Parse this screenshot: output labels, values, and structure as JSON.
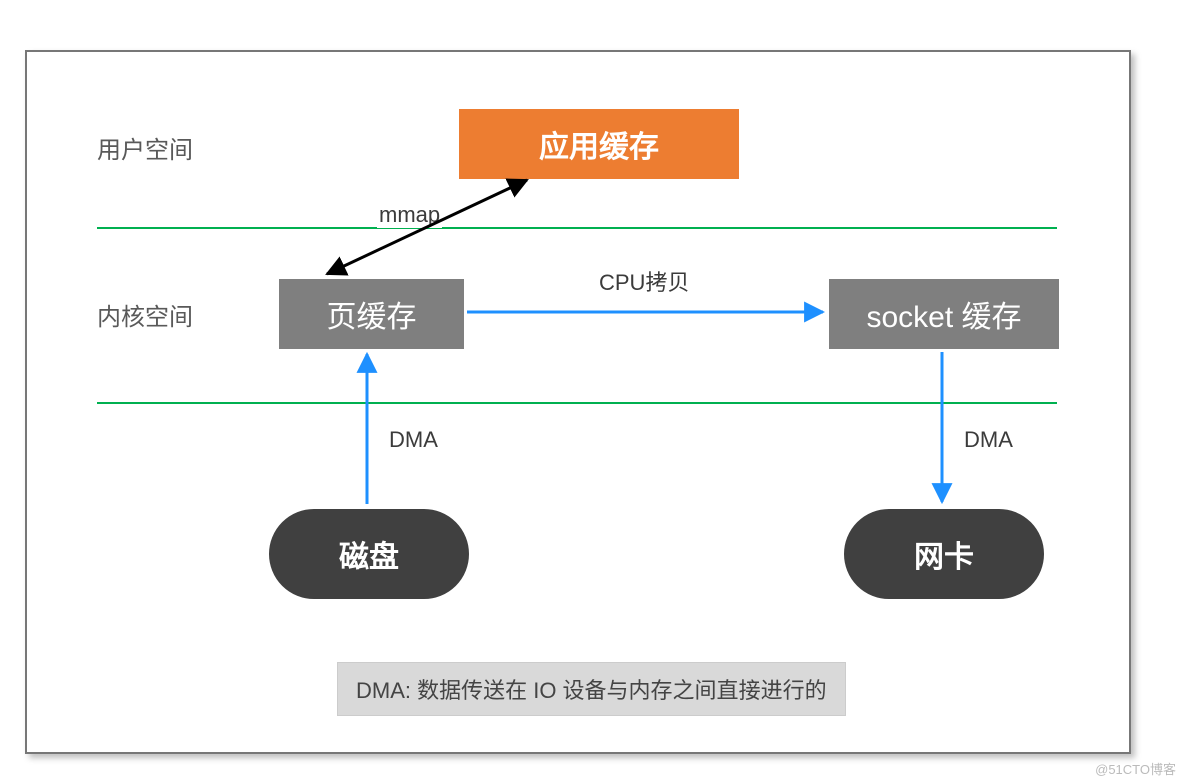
{
  "labels": {
    "user_space": "用户空间",
    "kernel_space": "内核空间"
  },
  "boxes": {
    "app_cache": "应用缓存",
    "page_cache": "页缓存",
    "socket_cache": "socket 缓存"
  },
  "pills": {
    "disk": "磁盘",
    "nic": "网卡"
  },
  "edges": {
    "mmap": "mmap",
    "cpu_copy": "CPU拷贝",
    "dma_left": "DMA",
    "dma_right": "DMA"
  },
  "note": "DMA: 数据传送在 IO 设备与内存之间直接进行的",
  "watermark": "@51CTO博客",
  "colors": {
    "orange": "#ED7D31",
    "gray": "#7F7F7F",
    "dark": "#404040",
    "green": "#00B050",
    "blue": "#1E90FF"
  }
}
